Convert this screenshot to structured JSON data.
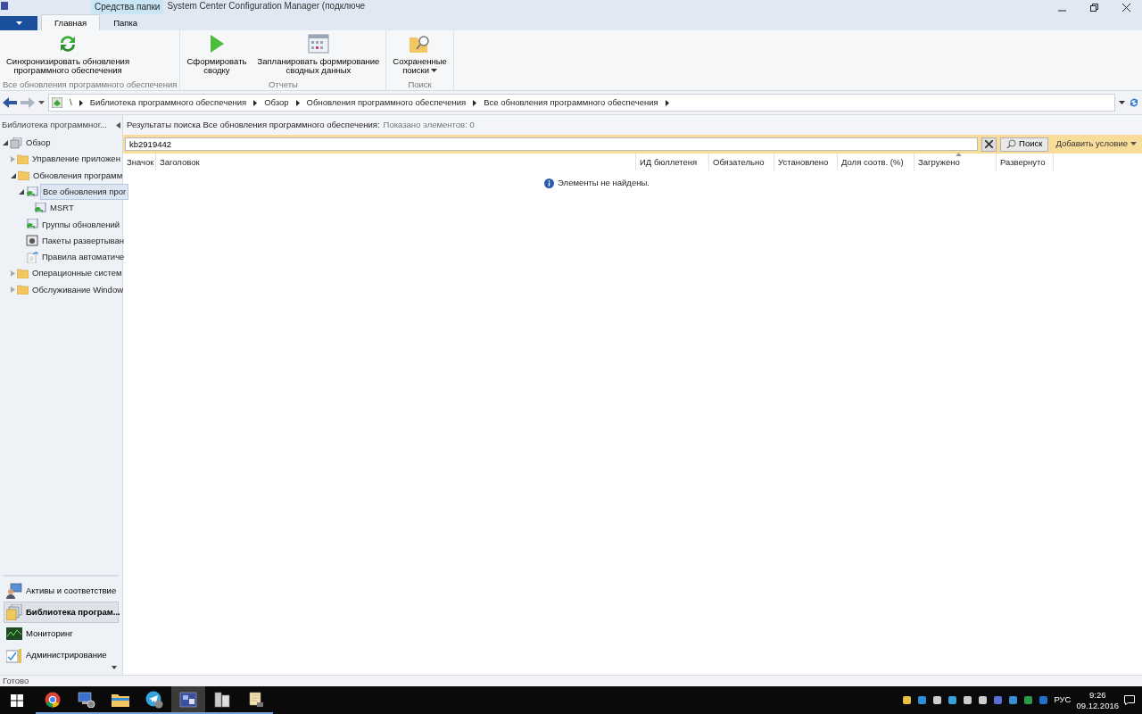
{
  "window": {
    "title": "System Center Configuration Manager (подключе"
  },
  "ribbon": {
    "context_tab": "Средства папки",
    "tabs": [
      {
        "label": "Главная",
        "selected": true
      },
      {
        "label": "Папка",
        "selected": false
      }
    ],
    "groups": [
      {
        "label": "Все обновления программного обеспечения",
        "buttons": [
          {
            "kind": "sync",
            "lines": [
              "Синхронизировать обновления",
              "программного обеспечения"
            ],
            "dropdown": false
          }
        ]
      },
      {
        "label": "Отчеты",
        "buttons": [
          {
            "kind": "play",
            "lines": [
              "Сформировать",
              "сводку"
            ],
            "dropdown": false
          },
          {
            "kind": "calendar",
            "lines": [
              "Запланировать формирование",
              "сводных данных"
            ],
            "dropdown": false
          }
        ]
      },
      {
        "label": "Поиск",
        "buttons": [
          {
            "kind": "saved-search",
            "lines": [
              "Сохраненные",
              "поиски"
            ],
            "dropdown": true
          }
        ]
      }
    ]
  },
  "address_bar": {
    "path": [
      "\\",
      "Библиотека программного обеспечения",
      "Обзор",
      "Обновления программного обеспечения",
      "Все обновления программного обеспечения"
    ]
  },
  "navigation": {
    "header": "Библиотека программног...",
    "tree": [
      {
        "label": "Обзор",
        "kind": "overview",
        "expanded": true,
        "selected": false,
        "children": [
          {
            "label": "Управление приложен",
            "kind": "folder",
            "expanded": false,
            "selected": false
          },
          {
            "label": "Обновления программ",
            "kind": "folder",
            "expanded": true,
            "selected": false,
            "children": [
              {
                "label": "Все обновления прог",
                "kind": "updates",
                "expanded": true,
                "selected": true,
                "children": [
                  {
                    "label": "MSRT",
                    "kind": "updates",
                    "selected": false
                  }
                ]
              },
              {
                "label": "Группы обновлений",
                "kind": "updates",
                "selected": false
              },
              {
                "label": "Пакеты развертыван",
                "kind": "package",
                "selected": false
              },
              {
                "label": "Правила автоматиче",
                "kind": "rule",
                "selected": false
              }
            ]
          },
          {
            "label": "Операционные систем",
            "kind": "folder",
            "expanded": false,
            "selected": false
          },
          {
            "label": "Обслуживание Window",
            "kind": "folder",
            "expanded": false,
            "selected": false
          }
        ]
      }
    ],
    "workspaces": [
      {
        "label": "Активы и соответствие",
        "kind": "assets",
        "selected": false
      },
      {
        "label": "Библиотека програм...",
        "kind": "library",
        "selected": true
      },
      {
        "label": "Мониторинг",
        "kind": "monitoring",
        "selected": false
      },
      {
        "label": "Администрирование",
        "kind": "admin",
        "selected": false
      }
    ]
  },
  "results": {
    "title": "Результаты поиска Все обновления программного обеспечения:",
    "count": "Показано элементов: 0",
    "search": {
      "value": "kb2919442",
      "button": "Поиск",
      "add_criteria": "Добавить условие"
    },
    "columns": [
      {
        "label": "Значок",
        "sorted": false
      },
      {
        "label": "Заголовок",
        "sorted": false
      },
      {
        "label": "ИД бюллетеня",
        "sorted": false
      },
      {
        "label": "Обязательно",
        "sorted": false
      },
      {
        "label": "Установлено",
        "sorted": false
      },
      {
        "label": "Доля соотв. (%)",
        "sorted": false
      },
      {
        "label": "Загружено",
        "sorted": true
      },
      {
        "label": "Развернуто",
        "sorted": false
      }
    ],
    "empty_message": "Элементы не найдены."
  },
  "status_bar": {
    "text": "Готово"
  },
  "taskbar": {
    "apps": [
      {
        "kind": "chrome",
        "active": false
      },
      {
        "kind": "remote",
        "active": false
      },
      {
        "kind": "explorer",
        "active": false
      },
      {
        "kind": "telegram",
        "active": false
      },
      {
        "kind": "console",
        "active": true
      },
      {
        "kind": "server",
        "active": false
      },
      {
        "kind": "script",
        "active": false
      }
    ],
    "language": "РУС",
    "time": "9:26",
    "date": "09.12.2016"
  }
}
